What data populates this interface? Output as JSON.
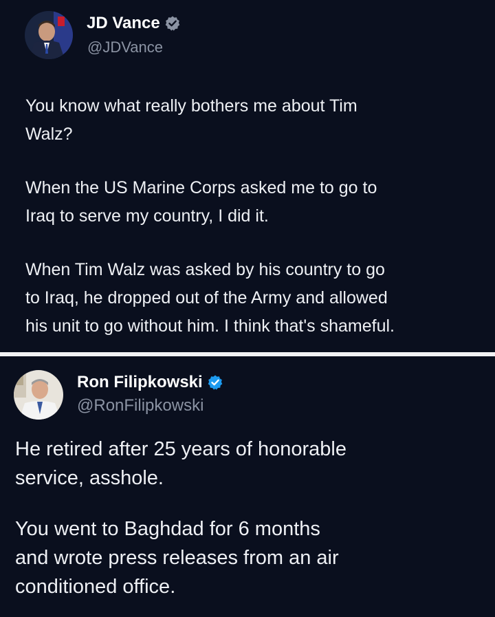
{
  "tweet1": {
    "display_name": "JD Vance",
    "handle": "@JDVance",
    "paragraphs": [
      "You know what really bothers me about Tim\nWalz?",
      "When the US Marine Corps asked me to go to\nIraq to serve my country, I did it.",
      "When Tim Walz was asked by his country to go\nto Iraq, he dropped out of the Army and allowed\nhis unit to go without him. I think that's shameful."
    ],
    "badge_color": "#8b93a3"
  },
  "tweet2": {
    "display_name": "Ron Filipkowski",
    "handle": "@RonFilipkowski",
    "paragraphs": [
      "He retired after 25 years of honorable\nservice, asshole.",
      "You went to Baghdad for 6 months\nand wrote press releases from an air\nconditioned office."
    ],
    "badge_color": "#1d9bf0"
  },
  "icons": [
    "avatar-photo",
    "verified-badge-icon"
  ]
}
